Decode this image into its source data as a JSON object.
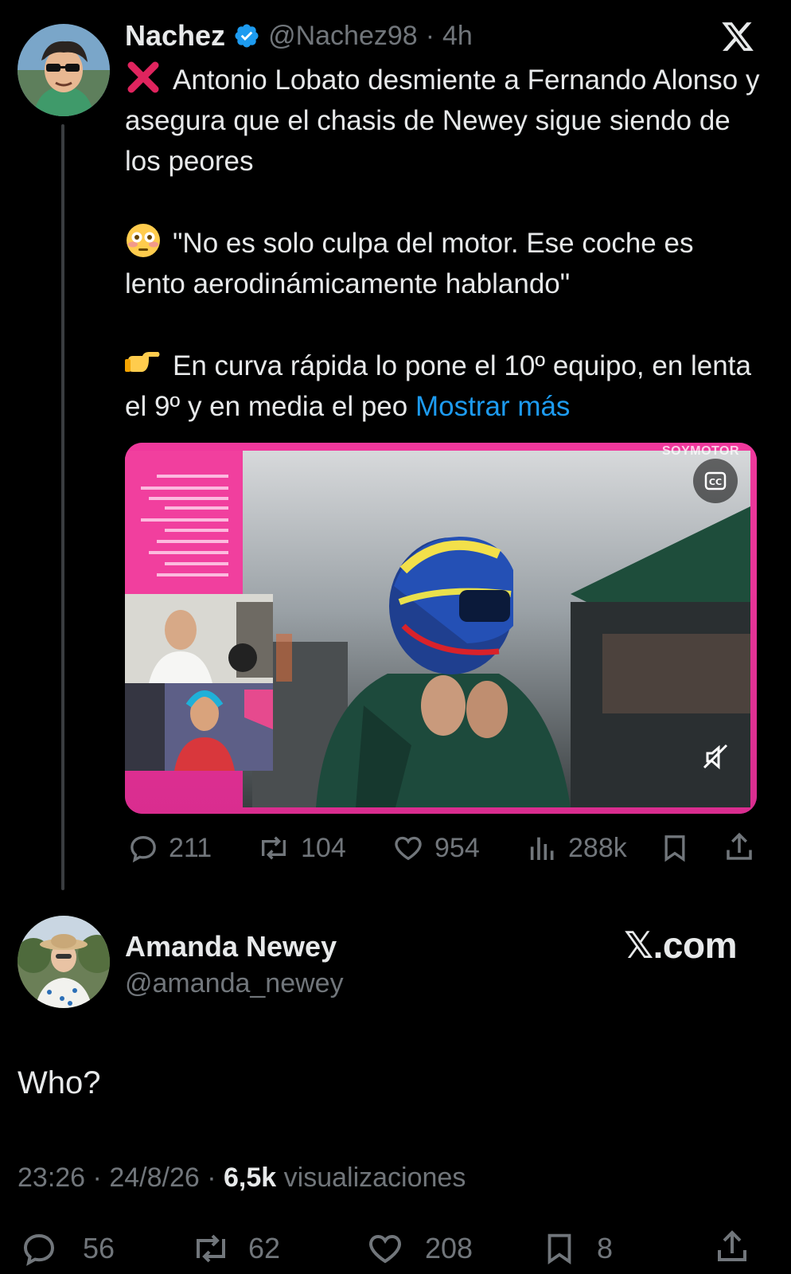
{
  "close_icon": "x-logo-icon",
  "tweet": {
    "author_name": "Nachez",
    "author_handle": "@Nachez98",
    "separator": "·",
    "time": "4h",
    "line1": "Antonio Lobato desmiente a Fernando Alonso y asegura que el chasis de Newey sigue siendo de los peores",
    "line2": "\"No es solo culpa del motor. Ese coche es lento aerodinámicamente hablando\"",
    "line3": "En curva rápida lo pone el 10º equipo, en lenta el 9º y en media el peo",
    "show_more": "Mostrar más",
    "media_watermark": "SOYMOTOR",
    "stats": {
      "replies": "211",
      "reposts": "104",
      "likes": "954",
      "views": "288k"
    }
  },
  "reply": {
    "author_name": "Amanda Newey",
    "author_handle": "@amanda_newey",
    "brand": "𝕏.com",
    "text": "Who?",
    "time": "23:26",
    "date": "24/8/26",
    "views_count": "6,5k",
    "views_label": "visualizaciones",
    "stats": {
      "replies": "56",
      "reposts": "62",
      "likes": "208",
      "bookmarks": "8"
    }
  },
  "colors": {
    "background": "#000000",
    "text": "#e7e9ea",
    "muted": "#71767b",
    "link": "#1d9bf0",
    "verified": "#1d9bf0",
    "media_frame": "#ff3e98"
  }
}
